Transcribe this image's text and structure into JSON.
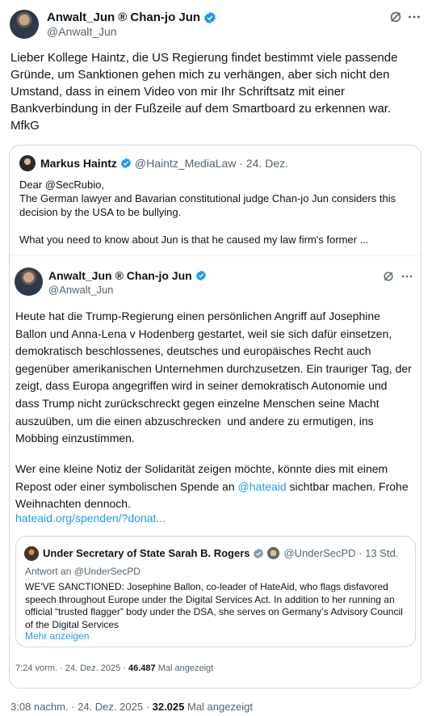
{
  "main": {
    "author_name": "Anwalt_Jun",
    "author_suffix": "® Chan-jo Jun",
    "handle": "@Anwalt_Jun",
    "body": "Lieber Kollege Haintz, die US Regierung findet bestimmt viele passende Gründe, um Sanktionen gehen mich zu verhängen, aber sich nicht den Umstand, dass in einem Video von mir Ihr Schriftsatz mit einer Bankverbindung in der Fußzeile auf dem Smartboard zu erkennen war. MfkG",
    "time": "3:08 nachm. · 24. Dez. 2025 · ",
    "views_count": "32.025",
    "views_label": " Mal angezeigt"
  },
  "quote1": {
    "author_name": "Markus Haintz",
    "handle_time": "@Haintz_MediaLaw · 24. Dez.",
    "body": "Dear @SecRubio,\nThe German lawyer and Bavarian constitutional judge Chan-jo Jun considers this decision by the USA to be bullying.\n\nWhat you need to know about Jun is that he caused my law firm's former ..."
  },
  "embedded": {
    "author_name": "Anwalt_Jun",
    "author_suffix": "® Chan-jo Jun",
    "handle": "@Anwalt_Jun",
    "body": "Heute hat die Trump-Regierung einen persönlichen Angriff auf Josephine Ballon und Anna-Lena v Hodenberg gestartet, weil sie sich dafür einsetzen, demokratisch beschlossenes, deutsches und europäisches Recht auch gegenüber amerikanischen Unternehmen durchzusetzen. Ein trauriger Tag, der zeigt, dass Europa angegriffen wird in seiner demokratisch Autonomie und dass Trump nicht zurückschreckt gegen einzelne Menschen seine Macht auszuüben, um die einen abzuschrecken  und andere zu ermutigen, ins Mobbing einzustimmen.",
    "body2_pre": "Wer eine kleine Notiz der Solidarität zeigen möchte, könnte dies mit einem Repost  oder einer symbolischen Spende an ",
    "body2_link": "@hateaid",
    "body2_post": " sichtbar machen.  Frohe Weihnachten dennoch.",
    "url": "hateaid.org/spenden/?donat...",
    "time": "7:24 vorm. · 24. Dez. 2025 · ",
    "views_count": "46.487",
    "views_label": " Mal angezeigt"
  },
  "quote2": {
    "author_name": "Under Secretary of State Sarah B. Rogers",
    "handle_time": "@UnderSecPD · 13 Std.",
    "reply_to": "Antwort an @UnderSecPD",
    "body": "WE'VE SANCTIONED: Josephine Ballon, co-leader of HateAid, who flags disfavored speech throughout Europe under the Digital Services Act. In addition to her running an official “trusted flagger” body under the DSA, she serves on Germany’s Advisory Council of the Digital Services",
    "more": "Mehr anzeigen"
  },
  "colors": {
    "accent": "#1d9bf0",
    "text": "#0f1419",
    "muted": "#536471",
    "border": "#cfd9de",
    "verified": "#1d9bf0",
    "gov_badge": "#829aab"
  },
  "icons": [
    "grok-icon",
    "more-icon",
    "verified-badge-icon",
    "government-badge-icon",
    "seal-icon"
  ]
}
